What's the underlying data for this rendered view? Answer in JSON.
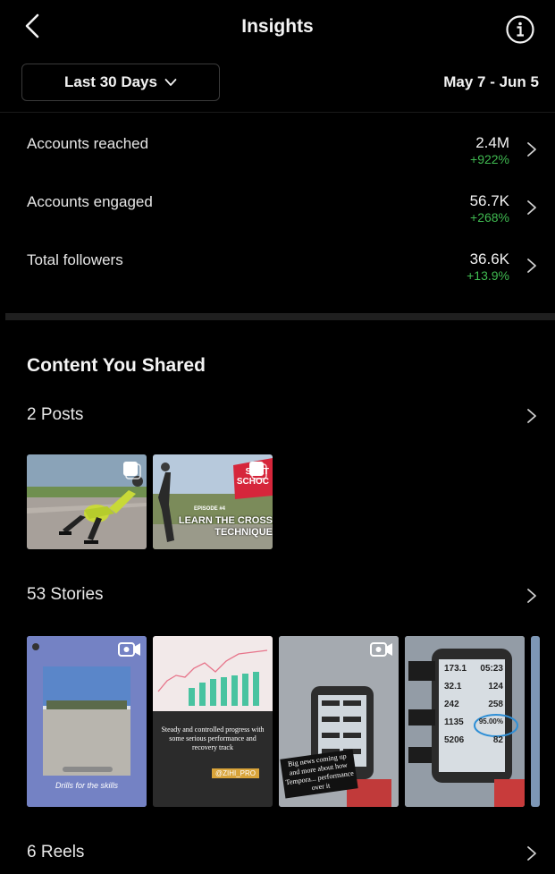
{
  "header": {
    "title": "Insights"
  },
  "date_filter": {
    "range_label": "Last 30 Days",
    "date_range": "May 7 - Jun 5"
  },
  "metrics": [
    {
      "label": "Accounts reached",
      "value": "2.4M",
      "change": "+922%"
    },
    {
      "label": "Accounts engaged",
      "value": "56.7K",
      "change": "+268%"
    },
    {
      "label": "Total followers",
      "value": "36.6K",
      "change": "+13.9%"
    }
  ],
  "content": {
    "title": "Content You Shared",
    "posts": {
      "label": "2 Posts",
      "items": [
        {
          "subject": "skater-photo"
        },
        {
          "subject": "skate-school-episode",
          "text_1": "SKAT",
          "text_2": "SCHOC",
          "episode": "EPISODE #4",
          "line_1": "LEARN THE CROSS",
          "line_2": "TECHNIQUE"
        }
      ]
    },
    "stories": {
      "label": "53 Stories",
      "items": [
        {
          "subject": "road-screenshot",
          "caption": "Drills for the skills"
        },
        {
          "subject": "chart-screenshot",
          "caption": "Steady and controlled progress with some serious performance and recovery track",
          "tag": "@ZIHI_PRO"
        },
        {
          "subject": "bike-computer",
          "caption": "Big news coming up and more about how Tempora... performance over it"
        },
        {
          "subject": "bike-computer-stats",
          "stat_1": "173.1",
          "stat_2": "05:23",
          "stat_3": "32.1",
          "stat_4": "124",
          "stat_5": "242",
          "stat_6": "258",
          "stat_7": "1135",
          "stat_8": "95.00%",
          "stat_9": "5206",
          "stat_10": "82"
        }
      ]
    },
    "reels": {
      "label": "6 Reels"
    }
  },
  "colors": {
    "positive_change": "#3fb950",
    "background": "#000000",
    "divider": "#1f1f1f"
  }
}
